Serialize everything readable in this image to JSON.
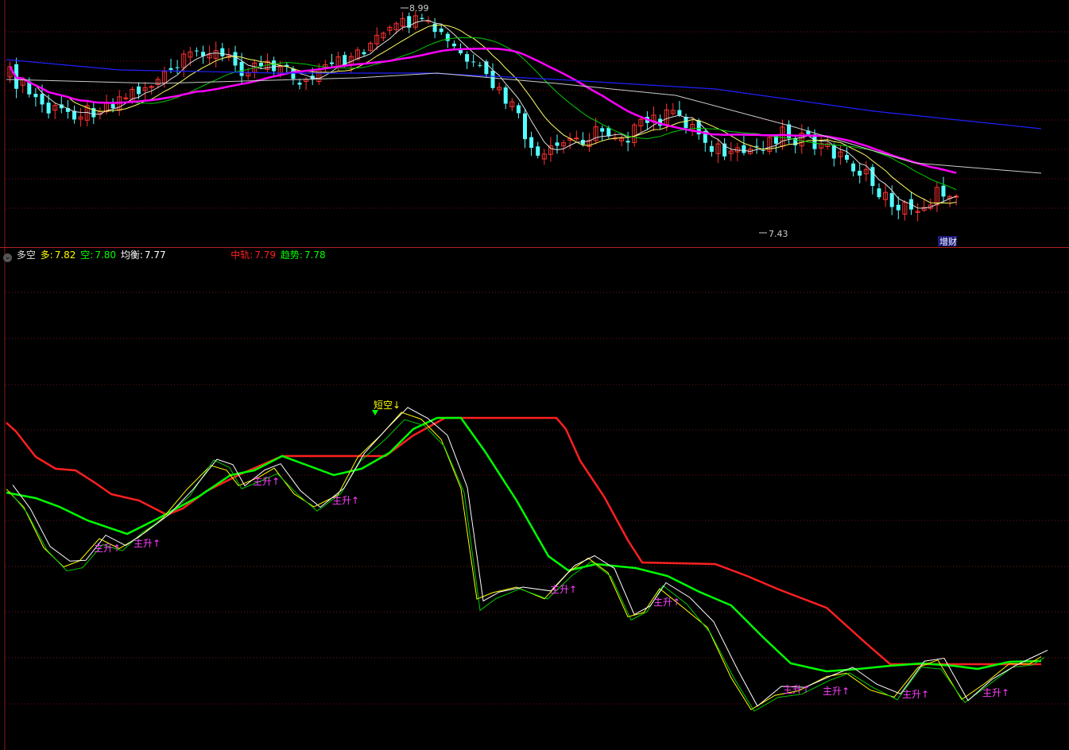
{
  "legend": {
    "name": "多空",
    "duo_label": "多:",
    "duo_value": "7.82",
    "kong_label": "空:",
    "kong_value": "7.80",
    "junheng_label": "均衡:",
    "junheng_value": "7.77",
    "zhonggui_label": "中轨:",
    "zhonggui_value": "7.79",
    "qushi_label": "趋势:",
    "qushi_value": "7.78",
    "colors": {
      "duo": "#ffff00",
      "kong": "#00ff00",
      "junheng": "#ffffff",
      "zhonggui": "#ff2020",
      "qushi": "#00ff00"
    }
  },
  "chart_data": [
    {
      "type": "candlestick",
      "high_label": "8.99",
      "low_label": "7.43",
      "tag": "增财",
      "colors": {
        "up": "#ff3232",
        "down": "#54ffff",
        "ma_magenta": "#ff00ff",
        "ma_blue": "#2020ff",
        "ma_white": "#dddddd",
        "ma_yellow": "#ffff60"
      }
    },
    {
      "type": "line",
      "series": [
        {
          "name": "中轨",
          "color": "#ff2020"
        },
        {
          "name": "趋势",
          "color": "#00ff00"
        },
        {
          "name": "多",
          "color": "#ffff00"
        },
        {
          "name": "空",
          "color": "#00cc00"
        },
        {
          "name": "均衡",
          "color": "#ffffff"
        }
      ],
      "signal_labels": {
        "short": "短空",
        "rise": "主升"
      }
    }
  ]
}
